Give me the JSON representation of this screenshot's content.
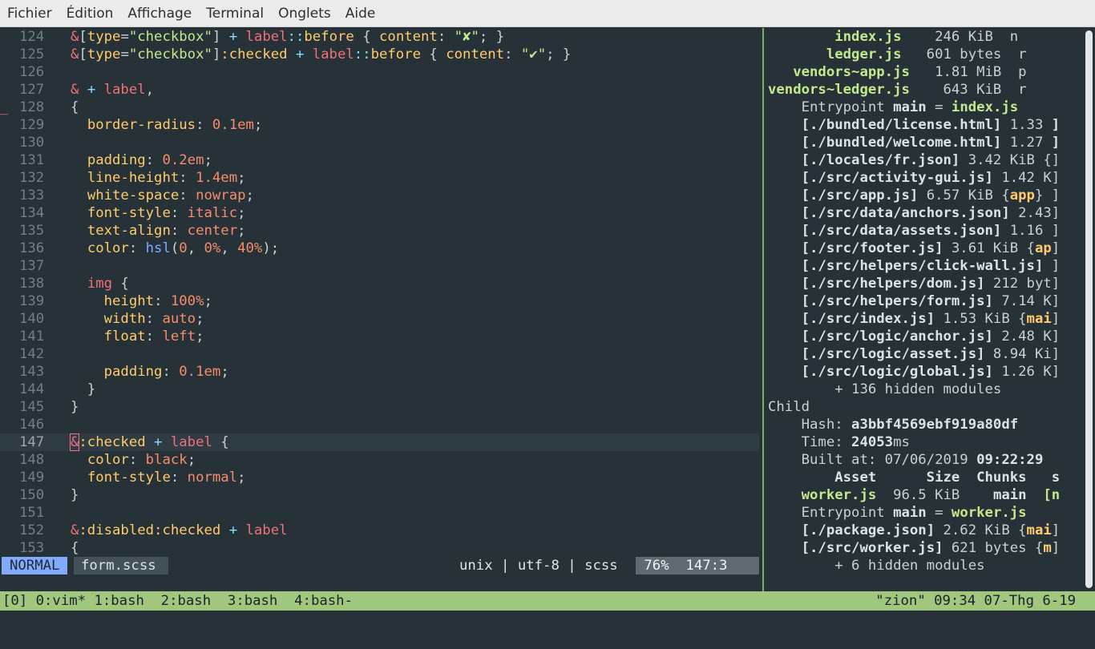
{
  "menubar": {
    "items": [
      "Fichier",
      "Édition",
      "Affichage",
      "Terminal",
      "Onglets",
      "Aide"
    ]
  },
  "editor": {
    "lines": [
      {
        "n": "124",
        "segs": [
          [
            "amp",
            "&"
          ],
          [
            "pu",
            "["
          ],
          [
            "at",
            "type"
          ],
          [
            "pu",
            "="
          ],
          [
            "st",
            "\"checkbox\""
          ],
          [
            "pu",
            "] "
          ],
          [
            "op",
            "+"
          ],
          [
            "pu",
            " "
          ],
          [
            "kw",
            "label"
          ],
          [
            "op",
            "::"
          ],
          [
            "at",
            "before"
          ],
          [
            "pu",
            " { "
          ],
          [
            "at",
            "content"
          ],
          [
            "pu",
            ": "
          ],
          [
            "st",
            "\"✘\""
          ],
          [
            "pu",
            "; }"
          ]
        ]
      },
      {
        "n": "125",
        "segs": [
          [
            "amp",
            "&"
          ],
          [
            "pu",
            "["
          ],
          [
            "at",
            "type"
          ],
          [
            "pu",
            "="
          ],
          [
            "st",
            "\"checkbox\""
          ],
          [
            "pu",
            "]"
          ],
          [
            "at",
            ":checked"
          ],
          [
            "pu",
            " "
          ],
          [
            "op",
            "+"
          ],
          [
            "pu",
            " "
          ],
          [
            "kw",
            "label"
          ],
          [
            "op",
            "::"
          ],
          [
            "at",
            "before"
          ],
          [
            "pu",
            " { "
          ],
          [
            "at",
            "content"
          ],
          [
            "pu",
            ": "
          ],
          [
            "st",
            "\"✔\""
          ],
          [
            "pu",
            "; }"
          ]
        ]
      },
      {
        "n": "126",
        "segs": []
      },
      {
        "n": "127",
        "segs": [
          [
            "amp",
            "&"
          ],
          [
            "pu",
            " "
          ],
          [
            "op",
            "+"
          ],
          [
            "pu",
            " "
          ],
          [
            "kw",
            "label"
          ],
          [
            "pu",
            ","
          ]
        ]
      },
      {
        "n": "128",
        "segs": [
          [
            "pu",
            "{"
          ]
        ],
        "mark": "_"
      },
      {
        "n": "129",
        "segs": [
          [
            "pu",
            "  "
          ],
          [
            "at",
            "border-radius"
          ],
          [
            "pu",
            ": "
          ],
          [
            "nu",
            "0.1em"
          ],
          [
            "pu",
            ";"
          ]
        ]
      },
      {
        "n": "130",
        "segs": []
      },
      {
        "n": "131",
        "segs": [
          [
            "pu",
            "  "
          ],
          [
            "at",
            "padding"
          ],
          [
            "pu",
            ": "
          ],
          [
            "nu",
            "0.2em"
          ],
          [
            "pu",
            ";"
          ]
        ]
      },
      {
        "n": "132",
        "segs": [
          [
            "pu",
            "  "
          ],
          [
            "at",
            "line-height"
          ],
          [
            "pu",
            ": "
          ],
          [
            "nu",
            "1.4em"
          ],
          [
            "pu",
            ";"
          ]
        ]
      },
      {
        "n": "133",
        "segs": [
          [
            "pu",
            "  "
          ],
          [
            "at",
            "white-space"
          ],
          [
            "pu",
            ": "
          ],
          [
            "nu",
            "nowrap"
          ],
          [
            "pu",
            ";"
          ]
        ]
      },
      {
        "n": "134",
        "segs": [
          [
            "pu",
            "  "
          ],
          [
            "at",
            "font-style"
          ],
          [
            "pu",
            ": "
          ],
          [
            "nu",
            "italic"
          ],
          [
            "pu",
            ";"
          ]
        ]
      },
      {
        "n": "135",
        "segs": [
          [
            "pu",
            "  "
          ],
          [
            "at",
            "text-align"
          ],
          [
            "pu",
            ": "
          ],
          [
            "nu",
            "center"
          ],
          [
            "pu",
            ";"
          ]
        ]
      },
      {
        "n": "136",
        "segs": [
          [
            "pu",
            "  "
          ],
          [
            "at",
            "color"
          ],
          [
            "pu",
            ": "
          ],
          [
            "fn",
            "hsl"
          ],
          [
            "pu",
            "("
          ],
          [
            "nu",
            "0"
          ],
          [
            "pu",
            ", "
          ],
          [
            "nu",
            "0%"
          ],
          [
            "pu",
            ", "
          ],
          [
            "nu",
            "40%"
          ],
          [
            "pu",
            ");"
          ]
        ]
      },
      {
        "n": "137",
        "segs": []
      },
      {
        "n": "138",
        "segs": [
          [
            "pu",
            "  "
          ],
          [
            "kw",
            "img"
          ],
          [
            "pu",
            " {"
          ]
        ]
      },
      {
        "n": "139",
        "segs": [
          [
            "pu",
            "    "
          ],
          [
            "at",
            "height"
          ],
          [
            "pu",
            ": "
          ],
          [
            "nu",
            "100%"
          ],
          [
            "pu",
            ";"
          ]
        ]
      },
      {
        "n": "140",
        "segs": [
          [
            "pu",
            "    "
          ],
          [
            "at",
            "width"
          ],
          [
            "pu",
            ": "
          ],
          [
            "nu",
            "auto"
          ],
          [
            "pu",
            ";"
          ]
        ]
      },
      {
        "n": "141",
        "segs": [
          [
            "pu",
            "    "
          ],
          [
            "at",
            "float"
          ],
          [
            "pu",
            ": "
          ],
          [
            "nu",
            "left"
          ],
          [
            "pu",
            ";"
          ]
        ]
      },
      {
        "n": "142",
        "segs": []
      },
      {
        "n": "143",
        "segs": [
          [
            "pu",
            "    "
          ],
          [
            "at",
            "padding"
          ],
          [
            "pu",
            ": "
          ],
          [
            "nu",
            "0.1em"
          ],
          [
            "pu",
            ";"
          ]
        ]
      },
      {
        "n": "144",
        "segs": [
          [
            "pu",
            "  }"
          ]
        ]
      },
      {
        "n": "145",
        "segs": [
          [
            "pu",
            "}"
          ]
        ]
      },
      {
        "n": "146",
        "segs": []
      },
      {
        "n": "147",
        "segs": [
          [
            "ampcur",
            "&"
          ],
          [
            "at",
            ":checked"
          ],
          [
            "pu",
            " "
          ],
          [
            "op",
            "+"
          ],
          [
            "pu",
            " "
          ],
          [
            "kw",
            "label"
          ],
          [
            "pu",
            " {"
          ]
        ],
        "current": true
      },
      {
        "n": "148",
        "segs": [
          [
            "pu",
            "  "
          ],
          [
            "at",
            "color"
          ],
          [
            "pu",
            ": "
          ],
          [
            "nu",
            "black"
          ],
          [
            "pu",
            ";"
          ]
        ]
      },
      {
        "n": "149",
        "segs": [
          [
            "pu",
            "  "
          ],
          [
            "at",
            "font-style"
          ],
          [
            "pu",
            ": "
          ],
          [
            "nu",
            "normal"
          ],
          [
            "pu",
            ";"
          ]
        ]
      },
      {
        "n": "150",
        "segs": [
          [
            "pu",
            "}"
          ]
        ]
      },
      {
        "n": "151",
        "segs": []
      },
      {
        "n": "152",
        "segs": [
          [
            "amp",
            "&"
          ],
          [
            "at",
            ":disabled:checked"
          ],
          [
            "pu",
            " "
          ],
          [
            "op",
            "+"
          ],
          [
            "pu",
            " "
          ],
          [
            "kw",
            "label"
          ]
        ]
      },
      {
        "n": "153",
        "segs": [
          [
            "pu",
            "{"
          ]
        ]
      }
    ]
  },
  "statusline": {
    "mode": "NORMAL",
    "filename": "form.scss",
    "fileinfo": "unix | utf-8 | scss",
    "position": " 76%  147:3"
  },
  "terminal": {
    "lines": [
      [
        [
          "g",
          "        index.js"
        ],
        [
          "pl",
          "    246 KiB  n"
        ]
      ],
      [
        [
          "g",
          "       ledger.js"
        ],
        [
          "pl",
          "   601 bytes  r"
        ]
      ],
      [
        [
          "g",
          "   vendors~app.js"
        ],
        [
          "pl",
          "   1.81 MiB  p"
        ]
      ],
      [
        [
          "g",
          "vendors~ledger.js"
        ],
        [
          "pl",
          "    643 KiB  r"
        ]
      ],
      [
        [
          "pl",
          "    Entrypoint "
        ],
        [
          "w",
          "main"
        ],
        [
          "pl",
          " = "
        ],
        [
          "g",
          "index.js"
        ]
      ],
      [
        [
          "pl",
          "    "
        ],
        [
          "w",
          "[./bundled/license.html]"
        ],
        [
          "pl",
          " 1.33 "
        ],
        [
          "w",
          "]"
        ]
      ],
      [
        [
          "pl",
          "    "
        ],
        [
          "w",
          "[./bundled/welcome.html]"
        ],
        [
          "pl",
          " 1.27 "
        ],
        [
          "w",
          "]"
        ]
      ],
      [
        [
          "pl",
          "    "
        ],
        [
          "w",
          "[./locales/fr.json]"
        ],
        [
          "pl",
          " 3.42 KiB {]"
        ]
      ],
      [
        [
          "pl",
          "    "
        ],
        [
          "w",
          "[./src/activity-gui.js]"
        ],
        [
          "pl",
          " 1.42 K]"
        ]
      ],
      [
        [
          "pl",
          "    "
        ],
        [
          "w",
          "[./src/app.js]"
        ],
        [
          "pl",
          " 6.57 KiB {"
        ],
        [
          "y",
          "app"
        ],
        [
          "pl",
          "} ]"
        ]
      ],
      [
        [
          "pl",
          "    "
        ],
        [
          "w",
          "[./src/data/anchors.json]"
        ],
        [
          "pl",
          " 2.43]"
        ]
      ],
      [
        [
          "pl",
          "    "
        ],
        [
          "w",
          "[./src/data/assets.json]"
        ],
        [
          "pl",
          " 1.16 ]"
        ]
      ],
      [
        [
          "pl",
          "    "
        ],
        [
          "w",
          "[./src/footer.js]"
        ],
        [
          "pl",
          " 3.61 KiB {"
        ],
        [
          "y",
          "ap"
        ],
        [
          "pl",
          "]"
        ]
      ],
      [
        [
          "pl",
          "    "
        ],
        [
          "w",
          "[./src/helpers/click-wall.js]"
        ],
        [
          "pl",
          " ]"
        ]
      ],
      [
        [
          "pl",
          "    "
        ],
        [
          "w",
          "[./src/helpers/dom.js]"
        ],
        [
          "pl",
          " 212 byt]"
        ]
      ],
      [
        [
          "pl",
          "    "
        ],
        [
          "w",
          "[./src/helpers/form.js]"
        ],
        [
          "pl",
          " 7.14 K]"
        ]
      ],
      [
        [
          "pl",
          "    "
        ],
        [
          "w",
          "[./src/index.js]"
        ],
        [
          "pl",
          " 1.53 KiB {"
        ],
        [
          "y",
          "mai"
        ],
        [
          "pl",
          "]"
        ]
      ],
      [
        [
          "pl",
          "    "
        ],
        [
          "w",
          "[./src/logic/anchor.js]"
        ],
        [
          "pl",
          " 2.48 K]"
        ]
      ],
      [
        [
          "pl",
          "    "
        ],
        [
          "w",
          "[./src/logic/asset.js]"
        ],
        [
          "pl",
          " 8.94 Ki]"
        ]
      ],
      [
        [
          "pl",
          "    "
        ],
        [
          "w",
          "[./src/logic/global.js]"
        ],
        [
          "pl",
          " 1.26 K]"
        ]
      ],
      [
        [
          "pl",
          "        + 136 hidden modules"
        ]
      ],
      [
        [
          "pl",
          "Child"
        ]
      ],
      [
        [
          "pl",
          "    Hash: "
        ],
        [
          "w",
          "a3bbf4569ebf919a80df"
        ]
      ],
      [
        [
          "pl",
          "    Time: "
        ],
        [
          "w",
          "24053"
        ],
        [
          "pl",
          "ms"
        ]
      ],
      [
        [
          "pl",
          "    Built at: 07/06/2019 "
        ],
        [
          "w",
          "09:22:29"
        ]
      ],
      [
        [
          "w",
          "        Asset      Size  Chunks   s"
        ]
      ],
      [
        [
          "g",
          "    worker.js"
        ],
        [
          "pl",
          "  96.5 KiB    "
        ],
        [
          "w",
          "main"
        ],
        [
          "pl",
          "  "
        ],
        [
          "g",
          "[n"
        ]
      ],
      [
        [
          "pl",
          "    Entrypoint "
        ],
        [
          "w",
          "main"
        ],
        [
          "pl",
          " = "
        ],
        [
          "g",
          "worker.js"
        ]
      ],
      [
        [
          "pl",
          "    "
        ],
        [
          "w",
          "[./package.json]"
        ],
        [
          "pl",
          " 2.62 KiB {"
        ],
        [
          "y",
          "mai"
        ],
        [
          "pl",
          "]"
        ]
      ],
      [
        [
          "pl",
          "    "
        ],
        [
          "w",
          "[./src/worker.js]"
        ],
        [
          "pl",
          " 621 bytes {"
        ],
        [
          "y",
          "m"
        ],
        [
          "pl",
          "]"
        ]
      ],
      [
        [
          "pl",
          "        + 6 hidden modules"
        ]
      ]
    ]
  },
  "tmux": {
    "windows": "[0] 0:vim* 1:bash  2:bash  3:bash  4:bash-",
    "status": "\"zion\" 09:34 07-Thg 6-19"
  },
  "colors": {
    "background": "#263238",
    "tmux_bar": "#9fc77d",
    "mode_badge": "#82aaff",
    "divider": "#7fb069"
  }
}
